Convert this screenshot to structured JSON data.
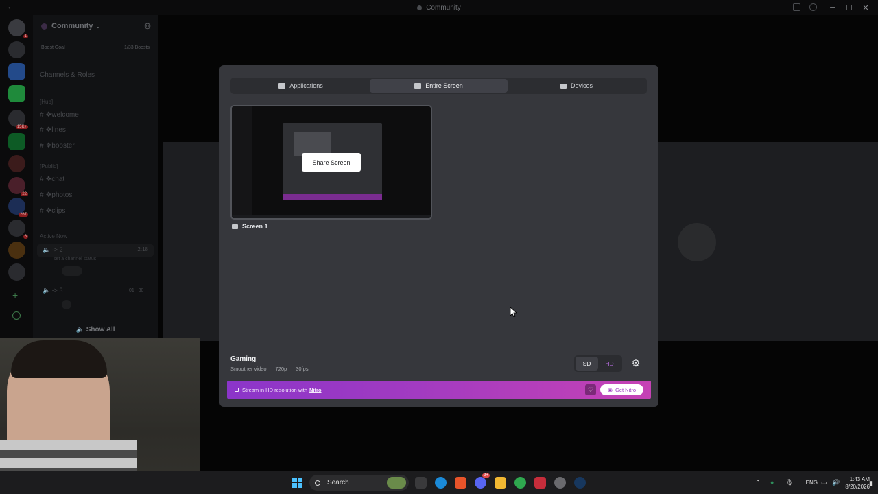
{
  "window": {
    "title": "Community"
  },
  "server": {
    "name": "Community",
    "boost_goal": "Boost Goal",
    "boost_count": "1/33 Boosts",
    "channels_roles": "Channels & Roles",
    "categories": [
      {
        "name": "[Hub]",
        "channels": [
          "❖welcome",
          "❖lines",
          "❖booster"
        ]
      },
      {
        "name": "[Public]",
        "channels": [
          "❖chat",
          "❖photos",
          "❖clips"
        ]
      }
    ],
    "active_now": "Active Now",
    "voice_channels": [
      {
        "name": "-> 2",
        "time": "2:18",
        "status": "set a channel status"
      },
      {
        "name": "-> 3",
        "count_a": "01",
        "count_b": "30"
      }
    ],
    "show_all": "Show All",
    "rail_badges": [
      "1",
      "15K+",
      "22",
      "267",
      "6"
    ]
  },
  "modal": {
    "tabs": [
      {
        "label": "Applications",
        "icon": "monitor-icon",
        "active": false
      },
      {
        "label": "Entire Screen",
        "icon": "monitor-icon",
        "active": true
      },
      {
        "label": "Devices",
        "icon": "camera-icon",
        "active": false
      }
    ],
    "share_button": "Share Screen",
    "screen_label": "Screen 1",
    "quality": {
      "title": "Gaming",
      "subtitle": "Smoother video",
      "resolution": "720p",
      "fps": "30fps",
      "options": [
        "SD",
        "HD"
      ],
      "selected": "SD"
    },
    "nitro_banner": {
      "text": "Stream in HD resolution with",
      "link": "Nitro",
      "button": "Get Nitro"
    }
  },
  "taskbar": {
    "search_placeholder": "Search",
    "language": "ENG",
    "time": "1:43 AM",
    "date": "8/20/2026",
    "discord_badge": "9+"
  },
  "colors": {
    "modal_bg": "#36373c",
    "nitro_gradient_start": "#8b35c9",
    "nitro_gradient_end": "#c642b5",
    "hd_accent": "#b06ad9"
  }
}
